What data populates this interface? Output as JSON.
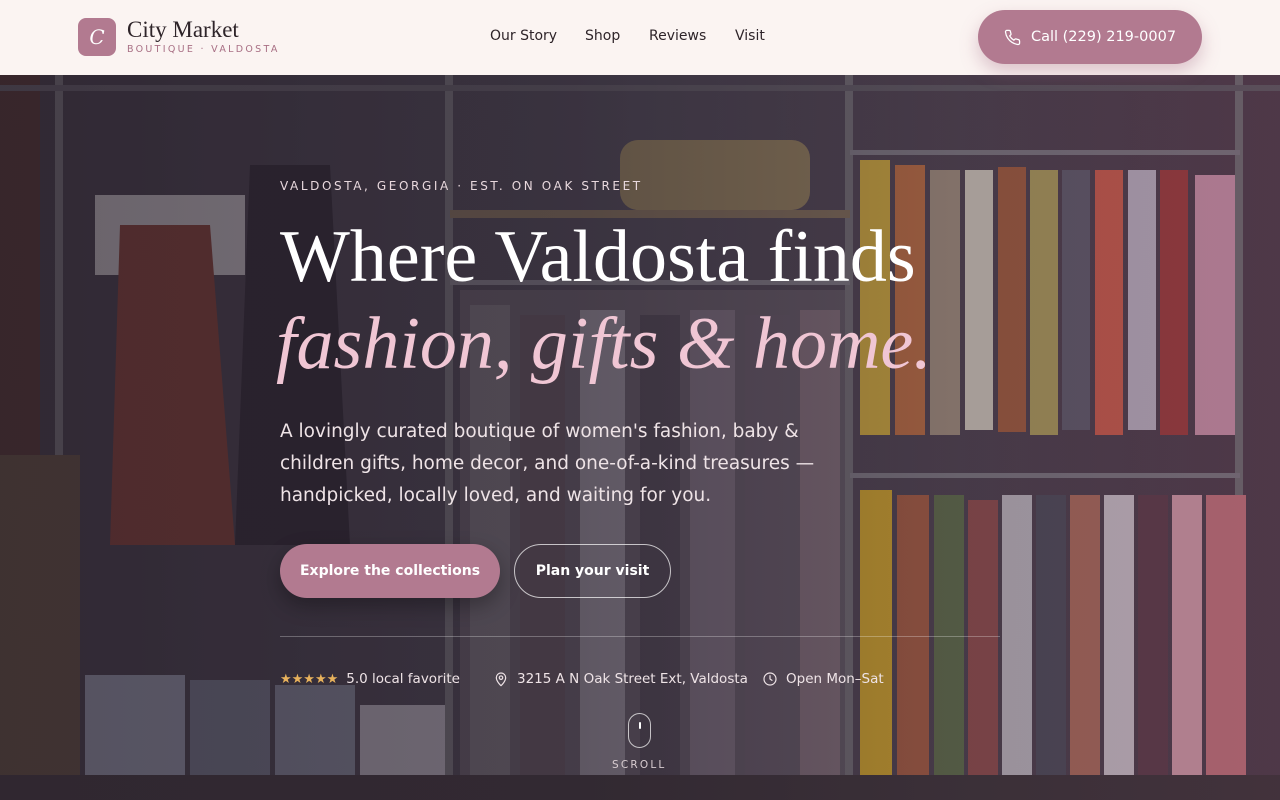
{
  "header": {
    "logo_letter": "C",
    "brand_name": "City Market",
    "brand_tagline": "BOUTIQUE · VALDOSTA",
    "nav": [
      "Our Story",
      "Shop",
      "Reviews",
      "Visit"
    ],
    "call_label": "Call (229) 219-0007"
  },
  "hero": {
    "eyebrow": "VALDOSTA, GEORGIA · EST. ON OAK STREET",
    "headline_line1": "Where Valdosta finds",
    "headline_line2": "fashion, gifts & home.",
    "lede": "A lovingly curated boutique of women's fashion, baby & children gifts, home decor, and one-of-a-kind treasures — handpicked, locally loved, and waiting for you.",
    "primary_cta": "Explore the collections",
    "secondary_cta": "Plan your visit",
    "rating_stars": "★★★★★",
    "rating_text": "5.0 local favorite",
    "address": "3215 A N Oak Street Ext, Valdosta",
    "hours": "Open Mon–Sat",
    "scroll_label": "SCROLL"
  },
  "colors": {
    "accent": "#b27a90",
    "accent_light": "#f0c6d4",
    "header_bg": "#fbf4f2",
    "star": "#e8b25c"
  }
}
